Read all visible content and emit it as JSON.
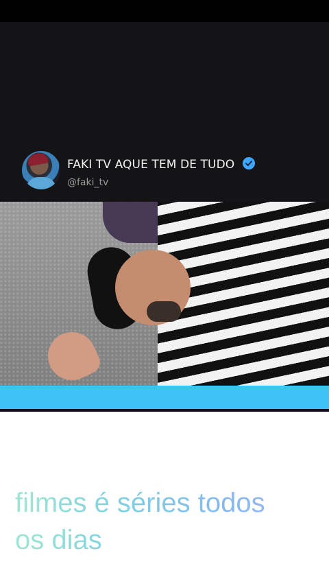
{
  "channel": {
    "name": "FAKI TV AQUE TEM DE TUDO",
    "handle": "@faki_tv",
    "verified": true
  },
  "caption": {
    "line1": "filmes é séries todos",
    "line2": " os dias"
  },
  "colors": {
    "accent_blue": "#3ec3f6",
    "verified_blue": "#3ea6ff",
    "header_bg": "#141416"
  },
  "icons": {
    "verified": "verified-badge-icon"
  }
}
